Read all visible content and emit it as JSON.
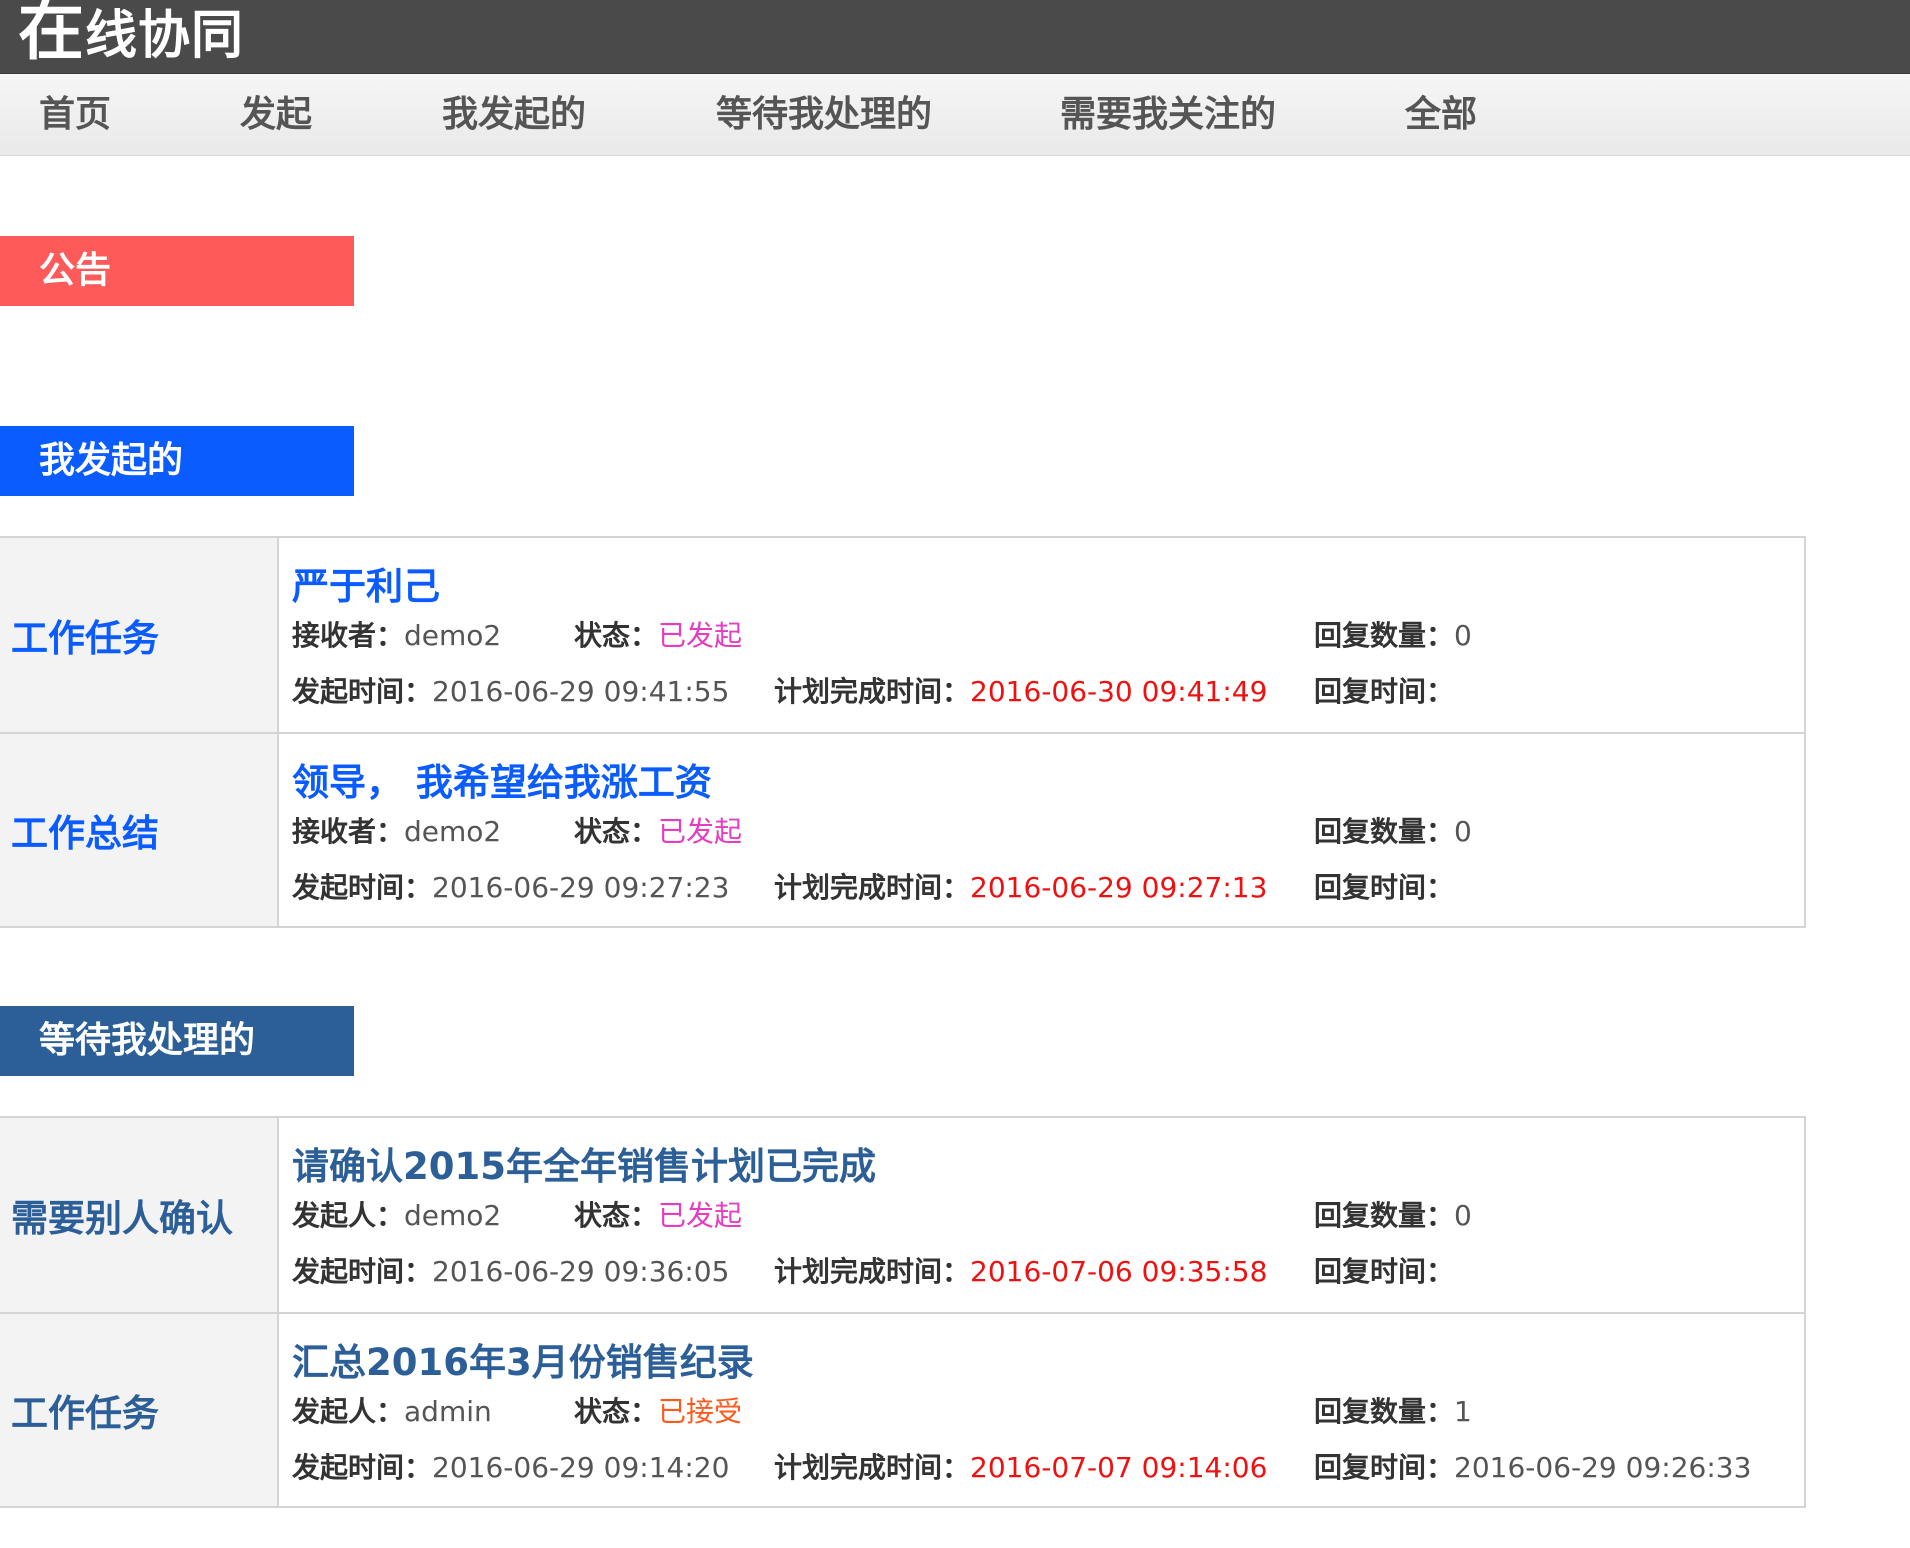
{
  "app": {
    "title_first": "在",
    "title_rest": "线协同"
  },
  "nav": [
    "首页",
    "发起",
    "我发起的",
    "等待我处理的",
    "需要我关注的",
    "全部"
  ],
  "colors": {
    "notice": "#ff5a5a",
    "mine": "#0a5cff",
    "waiting": "#2c5f98",
    "status_initiated": "#e63cc0",
    "status_accepted": "#ff5a1e",
    "deadline": "#ee1111"
  },
  "sections": {
    "notice": {
      "label": "公告"
    },
    "mine": {
      "label": "我发起的",
      "items": [
        {
          "category": "工作任务",
          "title": "严于利己",
          "person_key": "接收者：",
          "person": "demo2",
          "status_key": "状态：",
          "status": "已发起",
          "reply_count_key": "回复数量：",
          "reply_count": "0",
          "start_key": "发起时间：",
          "start": "2016-06-29 09:41:55",
          "deadline_key": "计划完成时间：",
          "deadline": "2016-06-30 09:41:49",
          "reply_time_key": "回复时间：",
          "reply_time": ""
        },
        {
          "category": "工作总结",
          "title": "领导， 我希望给我涨工资",
          "person_key": "接收者：",
          "person": "demo2",
          "status_key": "状态：",
          "status": "已发起",
          "reply_count_key": "回复数量：",
          "reply_count": "0",
          "start_key": "发起时间：",
          "start": "2016-06-29 09:27:23",
          "deadline_key": "计划完成时间：",
          "deadline": "2016-06-29 09:27:13",
          "reply_time_key": "回复时间：",
          "reply_time": ""
        }
      ]
    },
    "waiting": {
      "label": "等待我处理的",
      "items": [
        {
          "category": "需要别人确认",
          "title": "请确认2015年全年销售计划已完成",
          "person_key": "发起人：",
          "person": "demo2",
          "status_key": "状态：",
          "status": "已发起",
          "reply_count_key": "回复数量：",
          "reply_count": "0",
          "start_key": "发起时间：",
          "start": "2016-06-29 09:36:05",
          "deadline_key": "计划完成时间：",
          "deadline": "2016-07-06 09:35:58",
          "reply_time_key": "回复时间：",
          "reply_time": ""
        },
        {
          "category": "工作任务",
          "title": "汇总2016年3月份销售纪录",
          "person_key": "发起人：",
          "person": "admin",
          "status_key": "状态：",
          "status": "已接受",
          "reply_count_key": "回复数量：",
          "reply_count": "1",
          "start_key": "发起时间：",
          "start": "2016-06-29 09:14:20",
          "deadline_key": "计划完成时间：",
          "deadline": "2016-07-07 09:14:06",
          "reply_time_key": "回复时间：",
          "reply_time": "2016-06-29 09:26:33"
        }
      ]
    }
  }
}
